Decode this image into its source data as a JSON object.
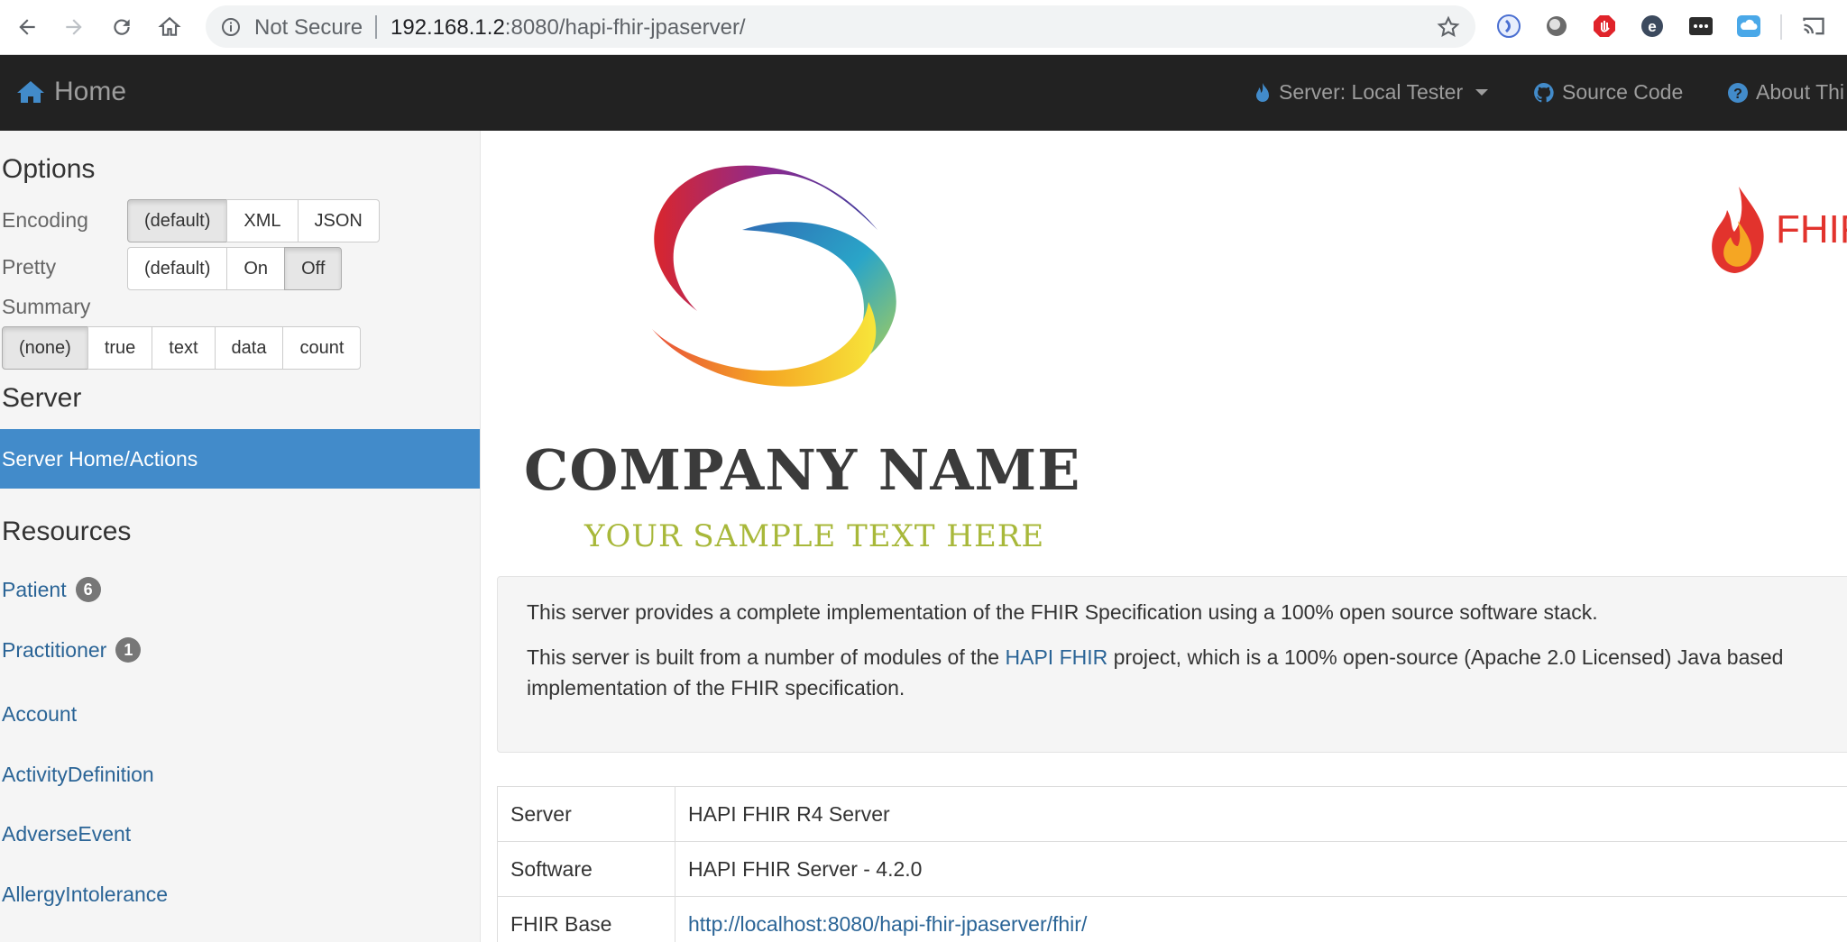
{
  "browser": {
    "security_label": "Not Secure",
    "url_host": "192.168.1.2",
    "url_rest": ":8080/hapi-fhir-jpaserver/"
  },
  "navbar": {
    "home_label": "Home",
    "server_label": "Server: Local Tester",
    "source_code_label": "Source Code",
    "about_label": "About Thi"
  },
  "sidebar": {
    "options_heading": "Options",
    "encoding_label": "Encoding",
    "encoding_options": [
      "(default)",
      "XML",
      "JSON"
    ],
    "pretty_label": "Pretty",
    "pretty_options": [
      "(default)",
      "On",
      "Off"
    ],
    "summary_label": "Summary",
    "summary_options": [
      "(none)",
      "true",
      "text",
      "data",
      "count"
    ],
    "server_heading": "Server",
    "server_home": "Server Home/Actions",
    "resources_heading": "Resources",
    "resources": [
      {
        "name": "Patient",
        "count": "6"
      },
      {
        "name": "Practitioner",
        "count": "1"
      },
      {
        "name": "Account"
      },
      {
        "name": "ActivityDefinition"
      },
      {
        "name": "AdverseEvent"
      },
      {
        "name": "AllergyIntolerance"
      }
    ]
  },
  "main": {
    "company_name": "COMPANY NAME",
    "tagline": "YOUR SAMPLE TEXT HERE",
    "fhir_logo_text": "FHIF",
    "intro_1": "This server provides a complete implementation of the FHIR Specification using a 100% open source software stack.",
    "intro_2_before": "This server is built from a number of modules of the ",
    "intro_2_link": "HAPI FHIR",
    "intro_2_after": " project, which is a 100% open-source (Apache 2.0 Licensed) Java based implementation of the FHIR specification.",
    "table": [
      {
        "key": "Server",
        "value": "HAPI FHIR R4 Server"
      },
      {
        "key": "Software",
        "value": "HAPI FHIR Server - 4.2.0"
      },
      {
        "key": "FHIR Base",
        "value": "http://localhost:8080/hapi-fhir-jpaserver/fhir/"
      }
    ]
  },
  "colors": {
    "navbar_bg": "#222222",
    "active_blue": "#428bca",
    "link_blue": "#2a6496",
    "badge_gray": "#777777"
  }
}
